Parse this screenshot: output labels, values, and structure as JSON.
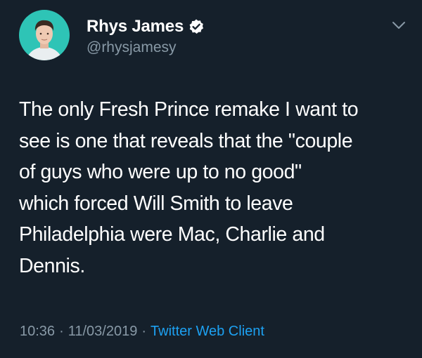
{
  "author": {
    "display_name": "Rhys James",
    "handle": "@rhysjamesy",
    "verified_icon": "verified-badge-icon",
    "avatar_icon": "profile-photo"
  },
  "menu_icon": "chevron-down-icon",
  "tweet": {
    "lines": [
      "The only Fresh Prince remake I want to",
      "see is one that reveals that the \"couple",
      "of guys who were up to no good\"",
      "which forced Will Smith to leave",
      "Philadelphia were Mac, Charlie and",
      "Dennis."
    ]
  },
  "meta": {
    "time": "10:36",
    "separator": "·",
    "date": "11/03/2019",
    "source": "Twitter Web Client"
  },
  "colors": {
    "background": "#15202b",
    "primary_text": "#ffffff",
    "secondary_text": "#8899a6",
    "link": "#1da1f2",
    "avatar_bg": "#2ec4b6"
  }
}
